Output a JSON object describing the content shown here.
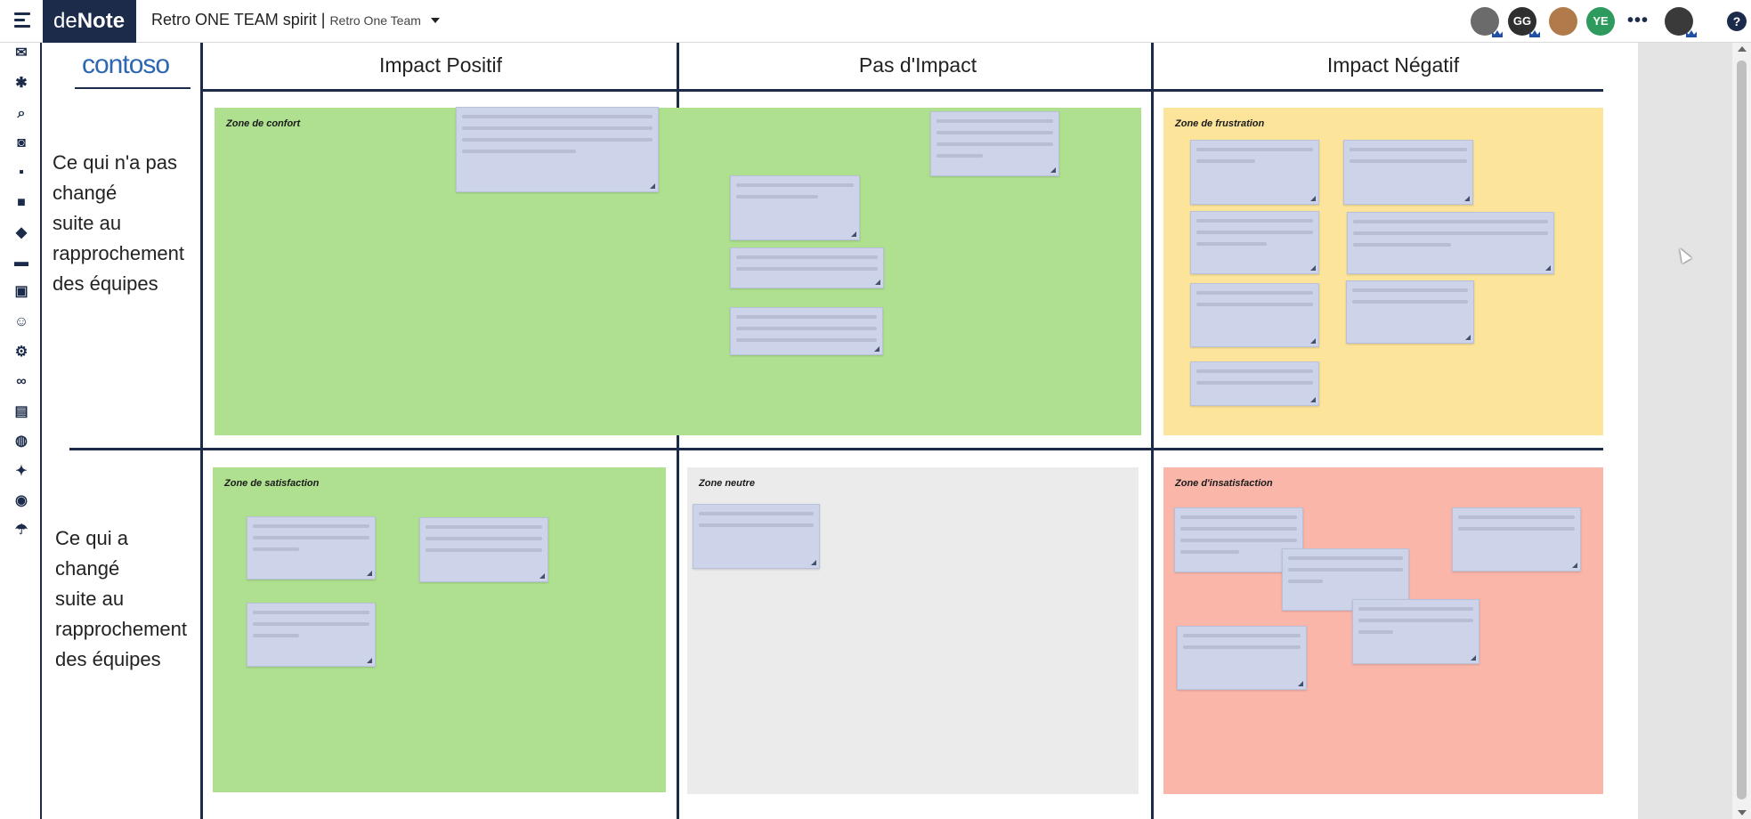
{
  "app": {
    "brand_prefix": "de",
    "brand_suffix": "Note",
    "title": "Retro ONE TEAM spirit",
    "separator": "|",
    "subtitle": "Retro One Team"
  },
  "header": {
    "users": [
      {
        "name": "user-avatar-1",
        "initials": "",
        "color": "#6b6b6b"
      },
      {
        "name": "user-avatar-gg",
        "initials": "GG",
        "color": "#2f2f2f"
      },
      {
        "name": "user-avatar-3",
        "initials": "",
        "color": "#b07a4a"
      },
      {
        "name": "user-avatar-ye",
        "initials": "YE",
        "color": "#2e9a5e"
      }
    ],
    "more_label": "•••",
    "help_label": "?"
  },
  "sidebar": {
    "icons": [
      "envelope-icon",
      "gear-icon",
      "search-icon",
      "media-icon",
      "note-icon",
      "square-icon",
      "tag-icon",
      "image-icon",
      "briefcase-icon",
      "smiley-icon",
      "settings-icon",
      "link-icon",
      "book-icon",
      "globe-icon",
      "magic-icon",
      "camera-icon",
      "umbrella-icon"
    ]
  },
  "board": {
    "logo": "contoso",
    "columns": [
      "Impact Positif",
      "Pas d'Impact",
      "Impact Négatif"
    ],
    "rows": [
      [
        "Ce qui n'a pas",
        "changé",
        "suite au",
        "rapprochement",
        "des équipes"
      ],
      [
        "Ce qui a",
        "changé",
        "suite au",
        "rapprochement",
        "des équipes"
      ]
    ],
    "zones": {
      "confort": "Zone de confort",
      "frustration": "Zone de frustration",
      "satisfaction": "Zone de satisfaction",
      "neutre": "Zone neutre",
      "insatisfaction": "Zone d'insatisfaction"
    },
    "colors": {
      "green": "#aee08f",
      "yellow": "#fce49a",
      "gray": "#ebebeb",
      "red": "#fbb6aa",
      "sticky": "#cdd3e8",
      "navy": "#1c2b4a"
    }
  }
}
